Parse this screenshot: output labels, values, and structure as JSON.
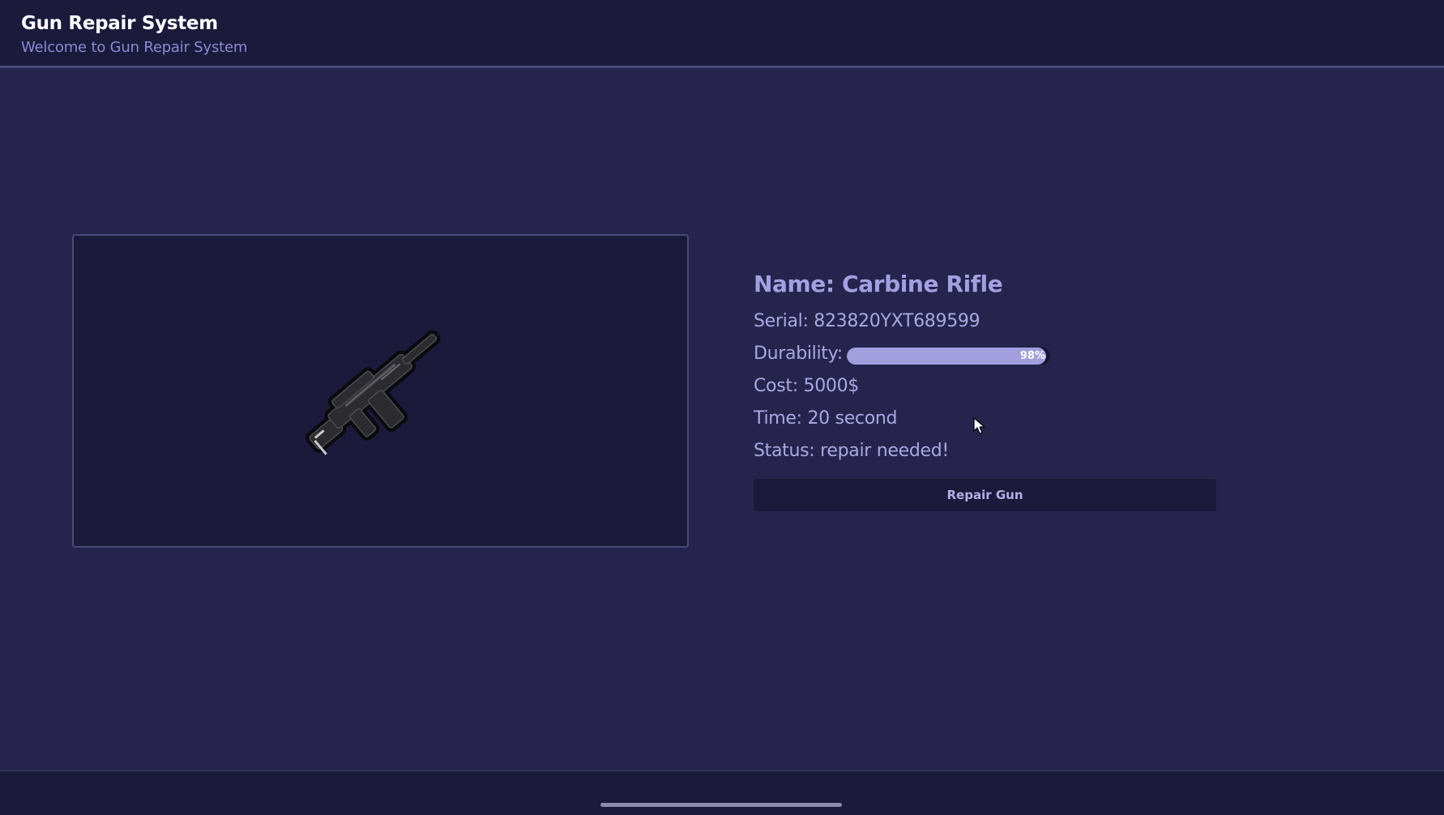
{
  "header": {
    "title": "Gun Repair System",
    "subtitle": "Welcome to Gun Repair System"
  },
  "gun": {
    "image_icon": "carbine-rifle-icon",
    "name_line": "Name: Carbine Rifle",
    "serial_line": "Serial: 823820YXT689599",
    "durability_label": "Durability:",
    "durability_percent": 98,
    "durability_text": "98%",
    "cost_line": "Cost: 5000$",
    "time_line": "Time: 20 second",
    "status_line": "Status: repair needed!"
  },
  "actions": {
    "repair_label": "Repair Gun"
  },
  "colors": {
    "background": "#26244c",
    "panel": "#1b1a3b",
    "accent": "#a39fde"
  }
}
